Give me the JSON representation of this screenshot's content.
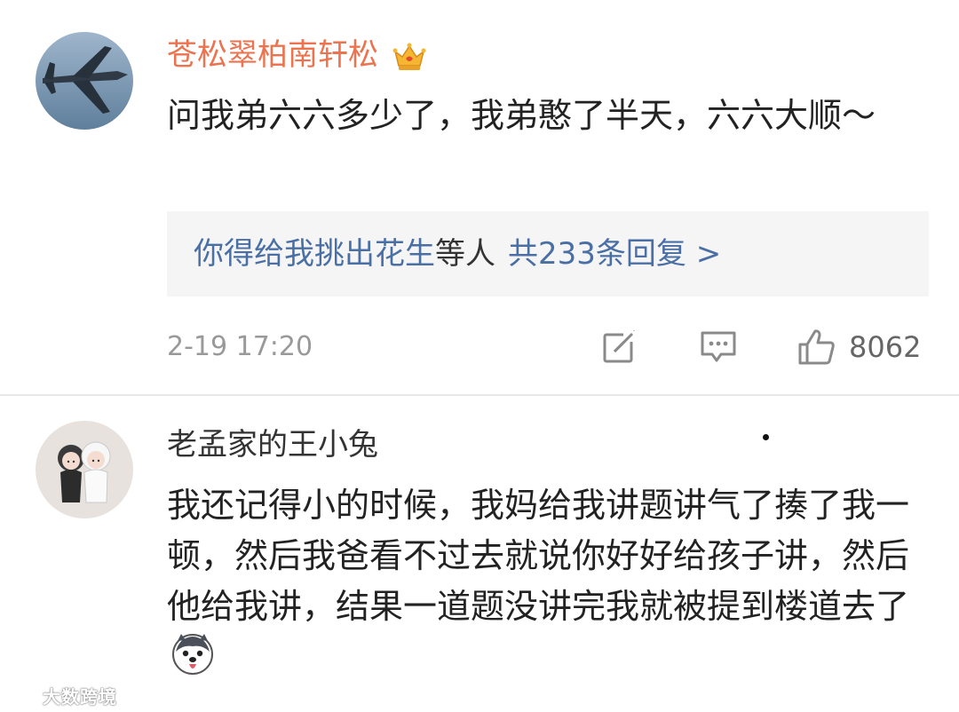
{
  "comments": [
    {
      "username": "苍松翠柏南轩松",
      "text": "问我弟六六多少了，我弟憨了半天，六六大顺～",
      "replies": {
        "names": "你得给我挑出花生",
        "suffix": "等人",
        "count": "共233条回复 >"
      },
      "timestamp": "2-19 17:20",
      "like_count": "8062"
    },
    {
      "username": "老孟家的王小兔",
      "text": "我还记得小的时候，我妈给我讲题讲气了揍了我一顿，然后我爸看不过去就说你好好给孩子讲，然后他给我讲，结果一道题没讲完我就被提到楼道去了"
    }
  ],
  "watermark": "大数跨境",
  "icons": {
    "vip": "crown-icon",
    "repost": "repost-icon",
    "comment": "comment-icon",
    "like": "thumbs-up-icon",
    "emoji": "husky-emoji-icon"
  },
  "colors": {
    "vip_name": "#eb7350",
    "link": "#4a6fa5",
    "meta": "#999999"
  }
}
